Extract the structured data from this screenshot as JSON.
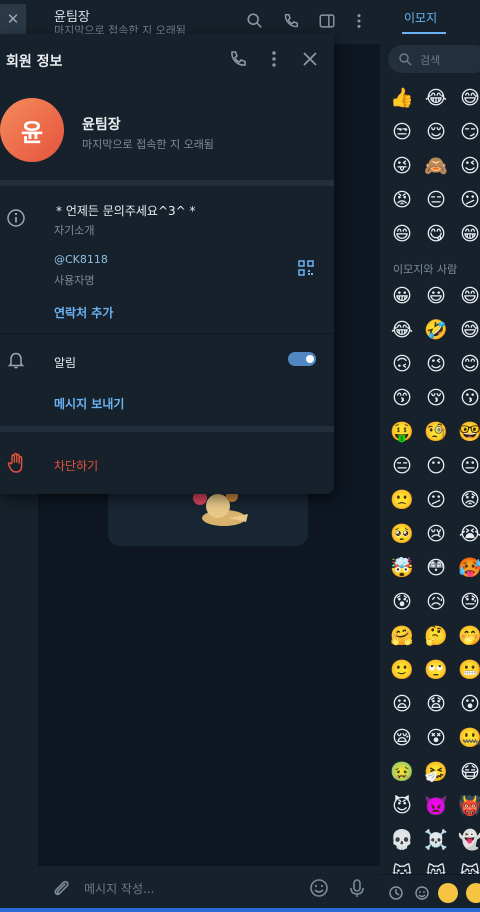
{
  "chat": {
    "title": "윤팀장",
    "subtitle": "마지막으로 접속한 지 오래됨",
    "composer_placeholder": "메시지 작성..."
  },
  "profile": {
    "title": "회원 정보",
    "avatar_letter": "윤",
    "avatar_color": "#e5533d",
    "name": "윤팀장",
    "status": "마지막으로 접속한 지 오래됨",
    "bio": "* 언제든 문의주세요^3^ *",
    "bio_label": "자기소개",
    "username": "@CK8118",
    "username_label": "사용자명",
    "add_contact": "연락처 추가",
    "notifications_label": "알림",
    "notifications_on": true,
    "send_message": "메시지 보내기",
    "block": "차단하기"
  },
  "emoji_panel": {
    "tab": "이모지",
    "search_placeholder": "검색",
    "section_label": "이모지와 사람",
    "recent": [
      [
        "👍",
        "😂",
        "😅"
      ],
      [
        "😒",
        "😌",
        "😏"
      ],
      [
        "😜",
        "🙈",
        "😉"
      ],
      [
        "😡",
        "😑",
        "😕"
      ],
      [
        "😄",
        "😋",
        "😁"
      ]
    ],
    "people": [
      [
        "😀",
        "😃",
        "😄"
      ],
      [
        "😂",
        "🤣",
        "😅"
      ],
      [
        "🙃",
        "😉",
        "😊"
      ],
      [
        "😙",
        "😚",
        "😗"
      ],
      [
        "🤑",
        "🧐",
        "🤓"
      ],
      [
        "😑",
        "😶",
        "😐"
      ],
      [
        "🙁",
        "😕",
        "😟"
      ],
      [
        "🥺",
        "😢",
        "😭"
      ],
      [
        "🤯",
        "😳",
        "🥵"
      ],
      [
        "😰",
        "😥",
        "😓"
      ],
      [
        "🤗",
        "🤔",
        "🤭"
      ],
      [
        "🙂",
        "🙄",
        "😬"
      ],
      [
        "😦",
        "😧",
        "😮"
      ],
      [
        "😪",
        "😵",
        "🤐"
      ],
      [
        "🤢",
        "🤧",
        "😷"
      ],
      [
        "😈",
        "👿",
        "👹"
      ],
      [
        "💀",
        "☠️",
        "👻"
      ],
      [
        "😺",
        "😸",
        "😹"
      ]
    ]
  },
  "colors": {
    "accent": "#6ab3f3",
    "danger": "#e5533d",
    "panel_bg": "#17212b",
    "chat_bg": "#0e1621"
  }
}
